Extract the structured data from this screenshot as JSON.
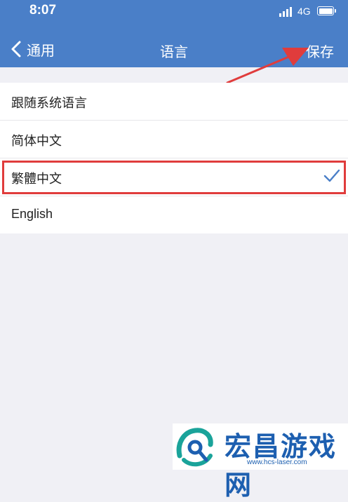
{
  "status": {
    "time": "8:07",
    "network": "4G"
  },
  "nav": {
    "back_label": "通用",
    "title": "语言",
    "save_label": "保存"
  },
  "options": [
    {
      "label": "跟随系统语言",
      "selected": false
    },
    {
      "label": "简体中文",
      "selected": false
    },
    {
      "label": "繁體中文",
      "selected": true
    },
    {
      "label": "English",
      "selected": false
    }
  ],
  "watermark": {
    "title": "宏昌游戏网",
    "url": "www.hcs-laser.com"
  },
  "colors": {
    "header": "#4a7fc8",
    "accent": "#4a7fc8",
    "highlight": "#e03c3c"
  }
}
